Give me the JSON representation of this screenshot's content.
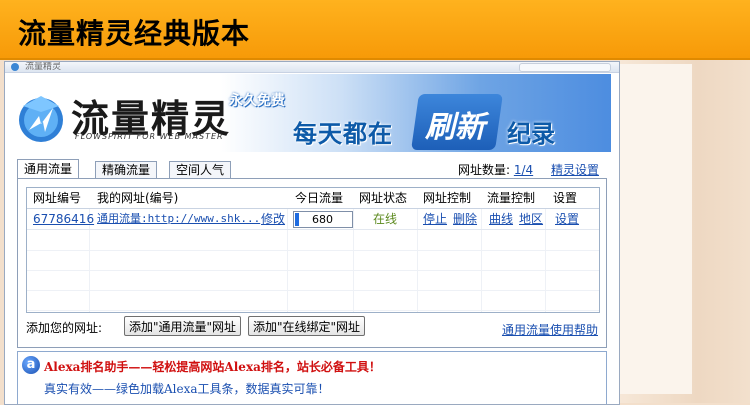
{
  "banner": {
    "title": "流量精灵经典版本"
  },
  "window": {
    "title_text": "流量精灵"
  },
  "app_banner": {
    "logo_name": "流量精灵",
    "logo_sub": "FLOWSPIRIT FOR WEB MASTER",
    "free_badge": "永久免费",
    "slogan_part1": "每天都在",
    "slogan_part2": "刷新",
    "slogan_part3": "纪录"
  },
  "tabs": [
    {
      "label": "通用流量",
      "active": true
    },
    {
      "label": "精确流量",
      "active": false
    },
    {
      "label": "空间人气",
      "active": false
    }
  ],
  "site_count": {
    "label": "网址数量:",
    "value": "1/4",
    "settings_link": "精灵设置"
  },
  "table": {
    "columns": [
      "网址编号",
      "我的网址(编号)",
      "今日流量",
      "网址状态",
      "网址控制",
      "流量控制",
      "设置"
    ],
    "rows": [
      {
        "id": "67786416",
        "url": "通用流量:http://www.shk...",
        "edit": "修改",
        "traffic": "680",
        "status": "在线",
        "stop": "停止",
        "delete": "删除",
        "curve": "曲线",
        "region": "地区",
        "settings": "设置"
      }
    ]
  },
  "add_site": {
    "label": "添加您的网址:",
    "button_general": "添加\"通用流量\"网址",
    "button_online": "添加\"在线绑定\"网址",
    "help_link": "通用流量使用帮助"
  },
  "promo": {
    "icon_letter": "a",
    "line1": "Alexa排名助手——轻松提高网站Alexa排名，站长必备工具！",
    "line2": "真实有效——绿色加载Alexa工具条，数据真实可靠！"
  },
  "colors": {
    "banner_orange": "#f79a08",
    "link_blue": "#1a4fb0",
    "alert_red": "#d01010",
    "online_green": "#5c8a1e"
  }
}
